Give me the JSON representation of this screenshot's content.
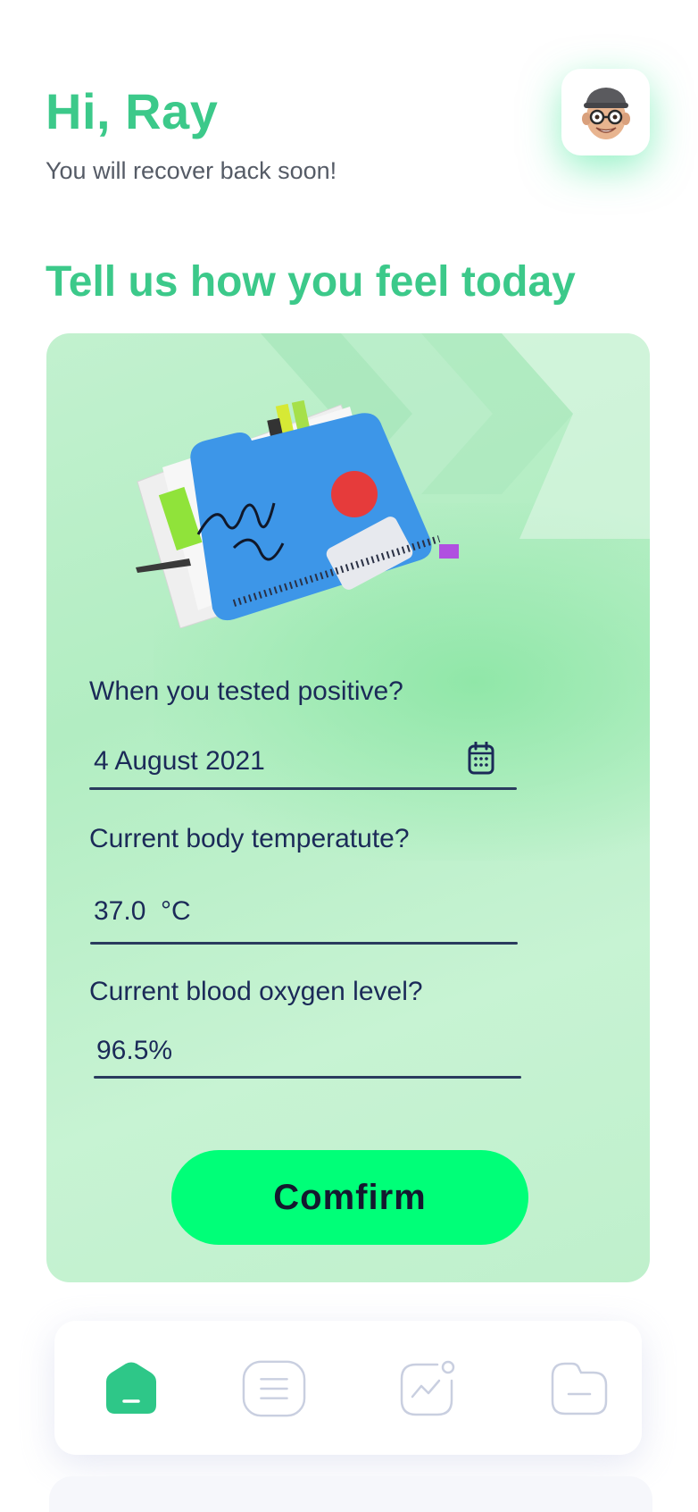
{
  "header": {
    "greeting": "Hi, Ray",
    "subtitle": "You will recover back soon!",
    "avatar_icon": "memoji-avatar-icon"
  },
  "section_title": "Tell us how you feel today",
  "form": {
    "illustration": "folder-illustration",
    "tested_positive": {
      "label": "When you tested positive?",
      "value": "4 August 2021",
      "icon": "calendar-icon"
    },
    "temperature": {
      "label": "Current body temperatute?",
      "value": "37.0  °C"
    },
    "oxygen": {
      "label": "Current blood oxygen level?",
      "value": "96.5%"
    },
    "confirm_label": "Comfirm"
  },
  "nav": {
    "items": [
      {
        "name": "home-icon",
        "active": true
      },
      {
        "name": "document-icon",
        "active": false
      },
      {
        "name": "activity-icon",
        "active": false
      },
      {
        "name": "folder-icon",
        "active": false
      }
    ]
  },
  "colors": {
    "accent_green": "#3cc98a",
    "button_green": "#00ff78",
    "text_navy": "#1b2a58",
    "card_bg": "#c2f1cf"
  }
}
